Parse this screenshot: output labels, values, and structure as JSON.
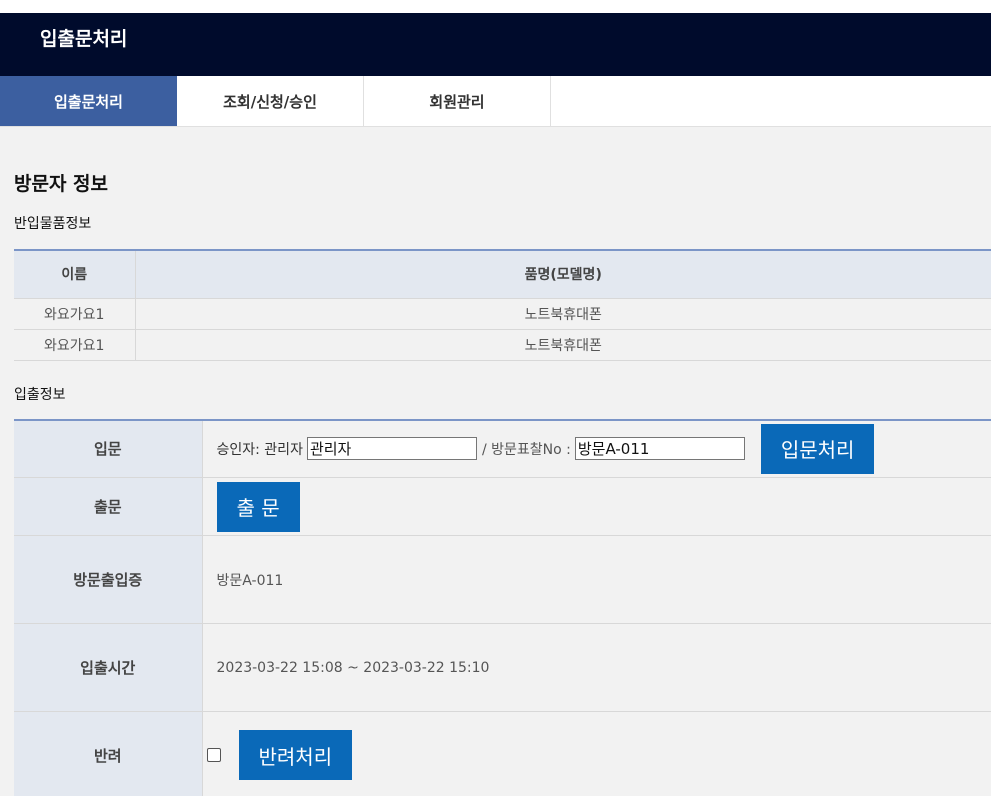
{
  "header": {
    "title": "입출문처리"
  },
  "tabs": [
    {
      "label": "입출문처리",
      "active": true
    },
    {
      "label": "조회/신청/승인",
      "active": false
    },
    {
      "label": "회원관리",
      "active": false
    }
  ],
  "page_title": "방문자 정보",
  "items_section": {
    "label": "반입물품정보",
    "headers": [
      "이름",
      "품명(모델명)"
    ],
    "rows": [
      [
        "와요가요1",
        "노트북휴대폰"
      ],
      [
        "와요가요1",
        "노트북휴대폰"
      ]
    ]
  },
  "io_section": {
    "label": "입출정보",
    "entry": {
      "label": "입문",
      "approver_prefix": "승인자: 관리자",
      "approver_value": "관리자",
      "visit_tag_label": "/ 방문표찰No :",
      "visit_tag_value": "방문A-011",
      "button": "입문처리"
    },
    "exit": {
      "label": "출문",
      "button": "출 문"
    },
    "pass": {
      "label": "방문출입증",
      "value": "방문A-011"
    },
    "time": {
      "label": "입출시간",
      "value": "2023-03-22 15:08 ~ 2023-03-22 15:10"
    },
    "reject": {
      "label": "반려",
      "button": "반려처리",
      "checked": false
    }
  },
  "colors": {
    "header_bg": "#000b2c",
    "tab_active": "#3c5fa0",
    "button": "#0a69b8",
    "table_header": "#e3e8f0"
  }
}
